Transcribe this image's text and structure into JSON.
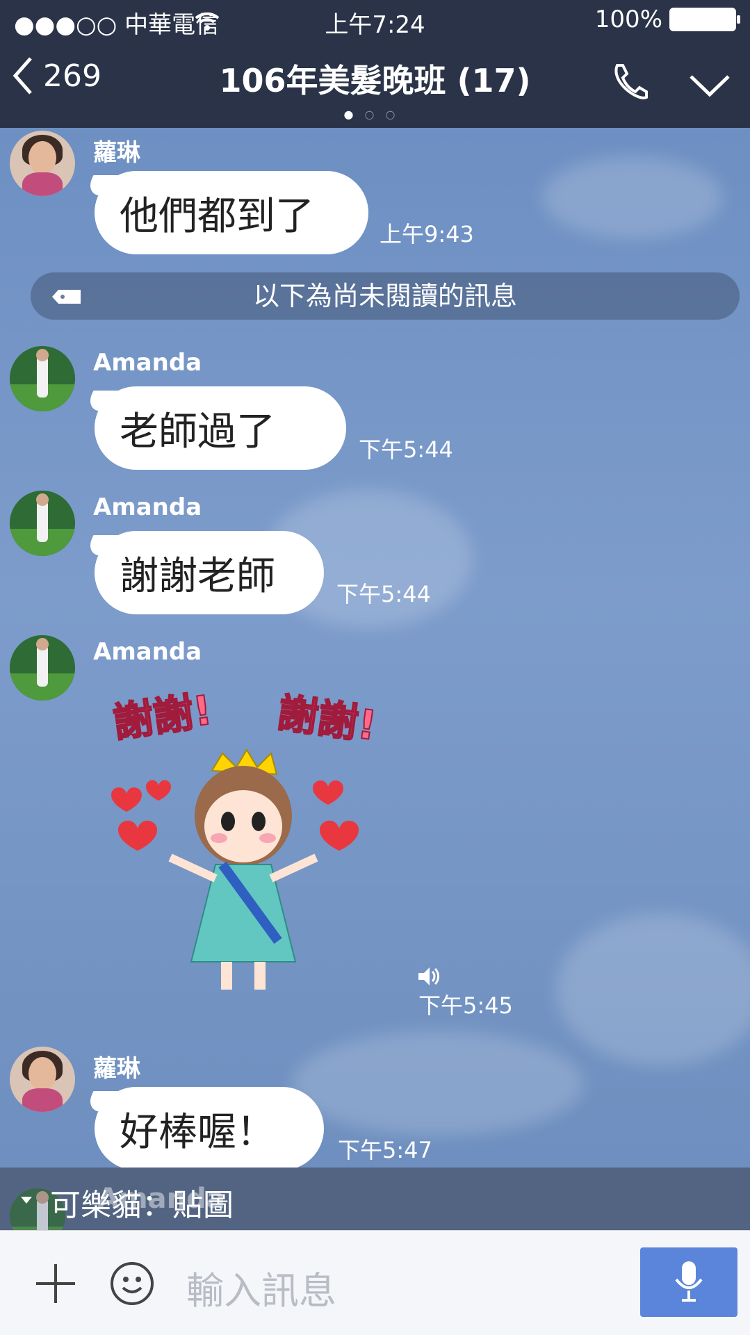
{
  "status_bar": {
    "carrier": "●●●○○ 中華電信",
    "time": "上午7:24",
    "battery": "100%"
  },
  "nav": {
    "back_count": "269",
    "title": "106年美髮晚班 (17)",
    "page_dots": [
      "●",
      "○",
      "○"
    ]
  },
  "messages": [
    {
      "sender": "蘿琳",
      "text": "他們都到了",
      "time": "上午9:43"
    },
    {
      "sender": "Amanda",
      "text": "老師過了",
      "time": "下午5:44"
    },
    {
      "sender": "Amanda",
      "text": "謝謝老師",
      "time": "下午5:44"
    },
    {
      "sender": "Amanda",
      "sticker_text_1": "謝謝!",
      "sticker_text_2": "謝謝!",
      "time": "下午5:45"
    },
    {
      "sender": "蘿琳",
      "text": "好棒喔！",
      "time": "下午5:47"
    }
  ],
  "unread_divider": "以下為尚未閱讀的訊息",
  "notification": "可樂貓：貼圖",
  "notification_overlap_sender": "Amanda",
  "input": {
    "placeholder": "輸入訊息"
  },
  "colors": {
    "header": "#2a3347",
    "chat_background": "#6f8fbf",
    "mic_button": "#5b85da"
  },
  "icons": [
    "back-chevron-icon",
    "phone-icon",
    "chevron-down-icon",
    "tag-icon",
    "plus-icon",
    "emoji-icon",
    "mic-icon",
    "speaker-icon"
  ]
}
